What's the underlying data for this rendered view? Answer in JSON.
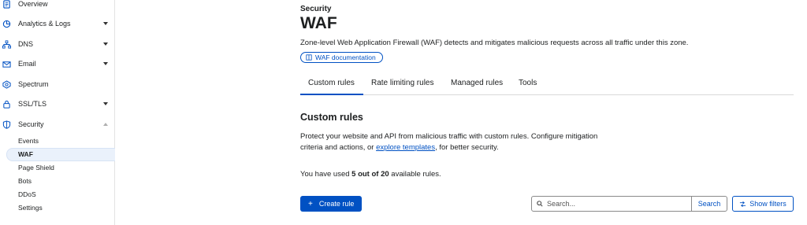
{
  "sidebar": {
    "items": [
      {
        "label": "Overview",
        "icon": "document-icon"
      },
      {
        "label": "Analytics & Logs",
        "icon": "chart-icon",
        "caret": "down"
      },
      {
        "label": "DNS",
        "icon": "network-icon",
        "caret": "down"
      },
      {
        "label": "Email",
        "icon": "email-icon",
        "caret": "down"
      },
      {
        "label": "Spectrum",
        "icon": "spectrum-icon"
      },
      {
        "label": "SSL/TLS",
        "icon": "lock-icon",
        "caret": "down"
      },
      {
        "label": "Security",
        "icon": "shield-icon",
        "caret": "up"
      }
    ],
    "sub_items": [
      {
        "label": "Events"
      },
      {
        "label": "WAF",
        "active": true
      },
      {
        "label": "Page Shield"
      },
      {
        "label": "Bots"
      },
      {
        "label": "DDoS"
      },
      {
        "label": "Settings"
      }
    ]
  },
  "header": {
    "breadcrumb": "Security",
    "title": "WAF",
    "description": "Zone-level Web Application Firewall (WAF) detects and mitigates malicious requests across all traffic under this zone.",
    "doc_link": "WAF documentation"
  },
  "tabs": [
    {
      "label": "Custom rules",
      "active": true
    },
    {
      "label": "Rate limiting rules"
    },
    {
      "label": "Managed rules"
    },
    {
      "label": "Tools"
    }
  ],
  "section": {
    "title": "Custom rules",
    "para_before_link": "Protect your website and API from malicious traffic with custom rules. Configure mitigation criteria and actions, or ",
    "link_text": "explore templates",
    "para_after_link": ", for better security.",
    "usage_prefix": "You have used ",
    "usage_bold": "5 out of 20",
    "usage_suffix": " available rules."
  },
  "toolbar": {
    "create_label": "Create rule",
    "search_placeholder": "Search...",
    "search_button": "Search",
    "filters_button": "Show filters"
  },
  "colors": {
    "accent": "#0051c3",
    "text": "#1d1f20"
  }
}
